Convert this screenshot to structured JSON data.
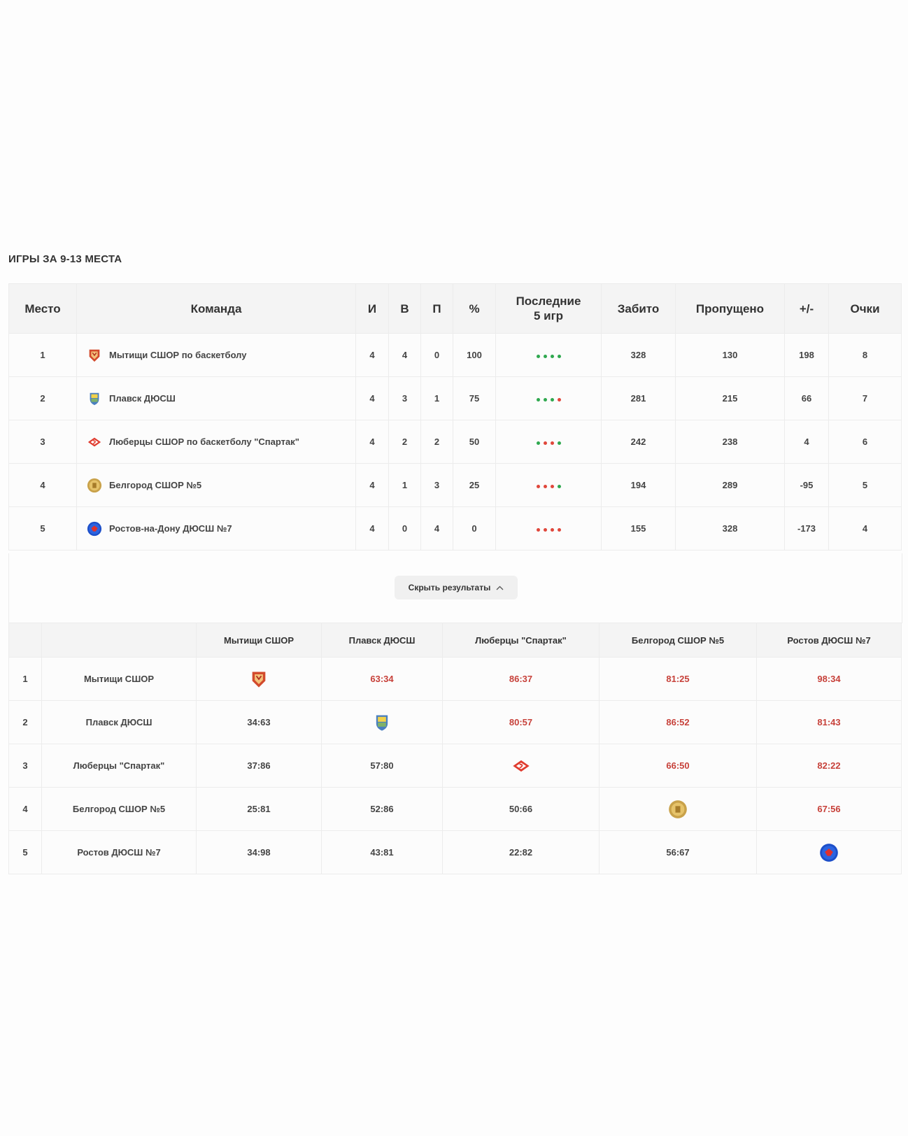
{
  "section": {
    "title": "ИГРЫ ЗА 9-13 МЕСТА"
  },
  "colors": {
    "win": "#2fa84f",
    "loss": "#e0473b",
    "score_win": "#c7413a",
    "header_bg": "#f4f4f4"
  },
  "standings": {
    "headers": {
      "place": "Место",
      "team": "Команда",
      "games": "И",
      "wins": "В",
      "losses": "П",
      "pct": "%",
      "last5_line1": "Последние",
      "last5_line2": "5 игр",
      "scored": "Забито",
      "conceded": "Пропущено",
      "diff": "+/-",
      "points": "Очки"
    },
    "rows": [
      {
        "place": "1",
        "logo": "mytishchi-logo",
        "team": "Мытищи СШОР по баскетболу",
        "games": "4",
        "wins": "4",
        "losses": "0",
        "pct": "100",
        "last5": [
          "w",
          "w",
          "w",
          "w"
        ],
        "scored": "328",
        "conceded": "130",
        "diff": "198",
        "points": "8"
      },
      {
        "place": "2",
        "logo": "plavsk-logo",
        "team": "Плавск ДЮСШ",
        "games": "4",
        "wins": "3",
        "losses": "1",
        "pct": "75",
        "last5": [
          "w",
          "w",
          "w",
          "l"
        ],
        "scored": "281",
        "conceded": "215",
        "diff": "66",
        "points": "7"
      },
      {
        "place": "3",
        "logo": "spartak-logo",
        "team": "Люберцы СШОР по баскетболу \"Спартак\"",
        "games": "4",
        "wins": "2",
        "losses": "2",
        "pct": "50",
        "last5": [
          "w",
          "l",
          "l",
          "w"
        ],
        "scored": "242",
        "conceded": "238",
        "diff": "4",
        "points": "6"
      },
      {
        "place": "4",
        "logo": "belgorod-logo",
        "team": "Белгород СШОР №5",
        "games": "4",
        "wins": "1",
        "losses": "3",
        "pct": "25",
        "last5": [
          "l",
          "l",
          "l",
          "w"
        ],
        "scored": "194",
        "conceded": "289",
        "diff": "-95",
        "points": "5"
      },
      {
        "place": "5",
        "logo": "rostov-logo",
        "team": "Ростов-на-Дону ДЮСШ №7",
        "games": "4",
        "wins": "0",
        "losses": "4",
        "pct": "0",
        "last5": [
          "l",
          "l",
          "l",
          "l"
        ],
        "scored": "155",
        "conceded": "328",
        "diff": "-173",
        "points": "4"
      }
    ]
  },
  "toggle": {
    "label": "Скрыть результаты",
    "icon": "chevron-up-icon"
  },
  "crosstable": {
    "headers": [
      "Мытищи СШОР",
      "Плавск ДЮСШ",
      "Люберцы \"Спартак\"",
      "Белгород СШОР №5",
      "Ростов ДЮСШ №7"
    ],
    "rows": [
      {
        "place": "1",
        "team": "Мытищи СШОР",
        "cells": [
          "",
          "63:34",
          "86:37",
          "81:25",
          "98:34"
        ]
      },
      {
        "place": "2",
        "team": "Плавск ДЮСШ",
        "cells": [
          "34:63",
          "",
          "80:57",
          "86:52",
          "81:43"
        ]
      },
      {
        "place": "3",
        "team": "Люберцы \"Спартак\"",
        "cells": [
          "37:86",
          "57:80",
          "",
          "66:50",
          "82:22"
        ]
      },
      {
        "place": "4",
        "team": "Белгород СШОР №5",
        "cells": [
          "25:81",
          "52:86",
          "50:66",
          "",
          "67:56"
        ]
      },
      {
        "place": "5",
        "team": "Ростов ДЮСШ №7",
        "cells": [
          "34:98",
          "43:81",
          "22:82",
          "56:67",
          ""
        ]
      }
    ]
  }
}
